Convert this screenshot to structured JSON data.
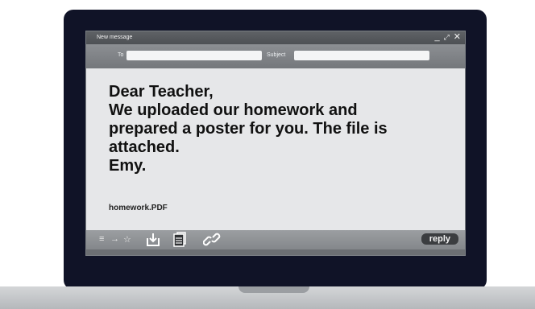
{
  "window": {
    "title": "New message",
    "controls": {
      "minimize": "_",
      "maximize": "⤢",
      "close": "✕"
    }
  },
  "header": {
    "to_label": "To",
    "to_value": "",
    "subject_label": "Subject",
    "subject_value": ""
  },
  "message": {
    "lines": [
      "Dear Teacher,",
      "We uploaded our homework and",
      "prepared a poster for you. The file is",
      "attached.",
      "Emy."
    ]
  },
  "attachment": {
    "filename": "homework.PDF"
  },
  "toolbar": {
    "icons": [
      "menu-icon",
      "forward-arrow-icon",
      "star-icon",
      "download-icon",
      "document-icon",
      "link-icon"
    ],
    "menu_glyph": "≡",
    "arrow_glyph": "→",
    "star_glyph": "☆",
    "reply_label": "reply"
  },
  "colors": {
    "screen_bezel": "#101327",
    "window_body": "#e6e7e9",
    "reply_button": "#3b3d40"
  }
}
